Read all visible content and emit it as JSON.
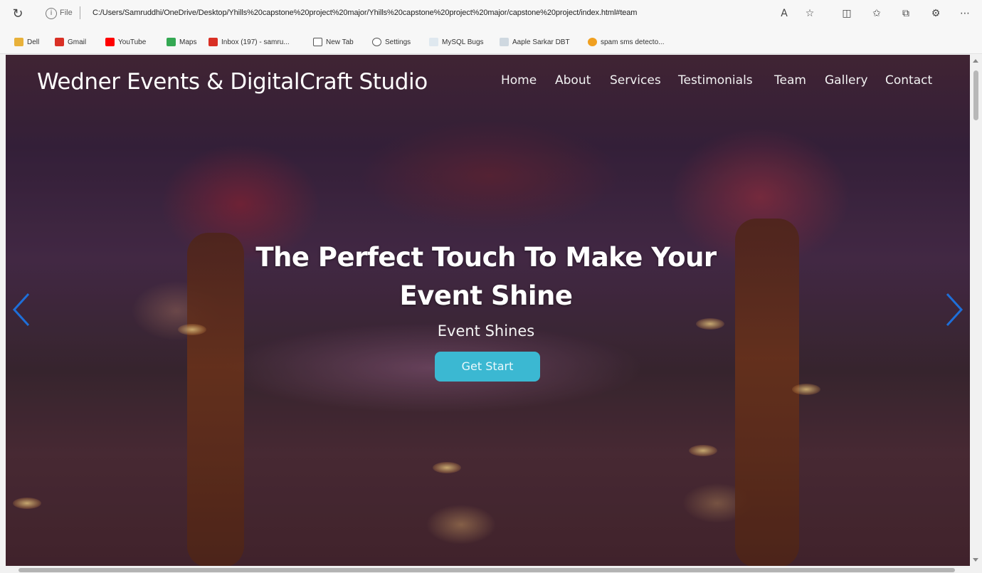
{
  "browser": {
    "file_label": "File",
    "url": "C:/Users/Samruddhi/OneDrive/Desktop/Yhills%20capstone%20project%20major/Yhills%20capstone%20project%20major/capstone%20project/index.html#team"
  },
  "bookmarks": [
    {
      "label": "Dell",
      "icon": "folder-icon",
      "color": "#e8b13a"
    },
    {
      "label": "Gmail",
      "icon": "gmail-icon",
      "color": "#d93025"
    },
    {
      "label": "YouTube",
      "icon": "youtube-icon",
      "color": "#ff0000"
    },
    {
      "label": "Maps",
      "icon": "maps-icon",
      "color": "#34a853"
    },
    {
      "label": "Inbox (197) - samru...",
      "icon": "gmail-icon",
      "color": "#d93025"
    },
    {
      "label": "New Tab",
      "icon": "page-icon",
      "color": "#555555"
    },
    {
      "label": "Settings",
      "icon": "gear-icon",
      "color": "#555555"
    },
    {
      "label": "MySQL Bugs",
      "icon": "mysql-icon",
      "color": "#4479a1"
    },
    {
      "label": "Aaple Sarkar DBT",
      "icon": "bookmark-icon",
      "color": "#e07b00"
    },
    {
      "label": "spam sms detecto...",
      "icon": "bookmark-icon",
      "color": "#f0a020"
    }
  ],
  "site": {
    "brand": "Wedner Events & DigitalCraft Studio",
    "nav": [
      "Home",
      "About",
      "Services",
      "Testimonials",
      "Team",
      "Gallery",
      "Contact"
    ]
  },
  "hero": {
    "title": "The Perfect Touch To Make Your Event Shine",
    "subtitle": "Event Shines",
    "cta_label": "Get Start",
    "cta_color": "#3bb8d2",
    "arrow_color": "#1e6fd9"
  }
}
